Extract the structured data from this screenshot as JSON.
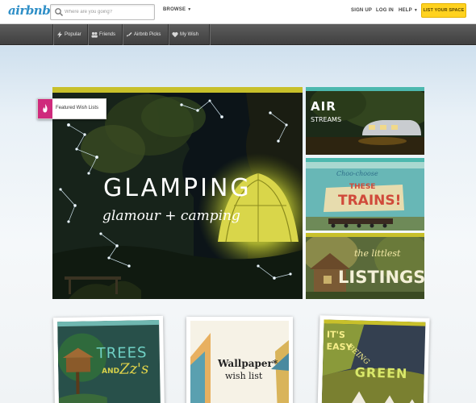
{
  "header": {
    "logo_text": "airbnb",
    "search_placeholder": "Where are you going?",
    "browse_label": "BROWSE",
    "signup_label": "SIGN UP",
    "login_label": "LOG IN",
    "help_label": "HELP",
    "list_space_label": "LIST YOUR SPACE"
  },
  "subnav": {
    "items": [
      {
        "label": "Popular",
        "icon": "lightning-icon"
      },
      {
        "label": "Friends",
        "icon": "people-icon"
      },
      {
        "label": "Airbnb Picks",
        "icon": "rocket-icon"
      },
      {
        "label": "My Wish Lists",
        "icon": "heart-icon"
      }
    ]
  },
  "featured": {
    "label": "Featured Wish Lists",
    "title": "GLAMPING",
    "subtitle": "glamour + camping"
  },
  "side_tiles": [
    {
      "line1": "AIR",
      "line2": "STREAMS"
    },
    {
      "line1": "Choo-choose",
      "line2": "THESE",
      "line3": "TRAINS!"
    },
    {
      "line1": "the littlest",
      "line2": "LISTINGS"
    }
  ],
  "cards": [
    {
      "line1": "TREES",
      "line2": "AND",
      "line3": "Zz's"
    },
    {
      "line1": "Wallpaper*",
      "line2": "wish list"
    },
    {
      "line1": "IT'S",
      "line2": "EASY",
      "line3": "BEING",
      "line4": "GREEN"
    }
  ],
  "colors": {
    "brand": "#2f8fc7",
    "accent_button": "#ffd21f",
    "featured_ribbon": "#cf2a7c",
    "nav_bg": "#4a4a4a"
  }
}
